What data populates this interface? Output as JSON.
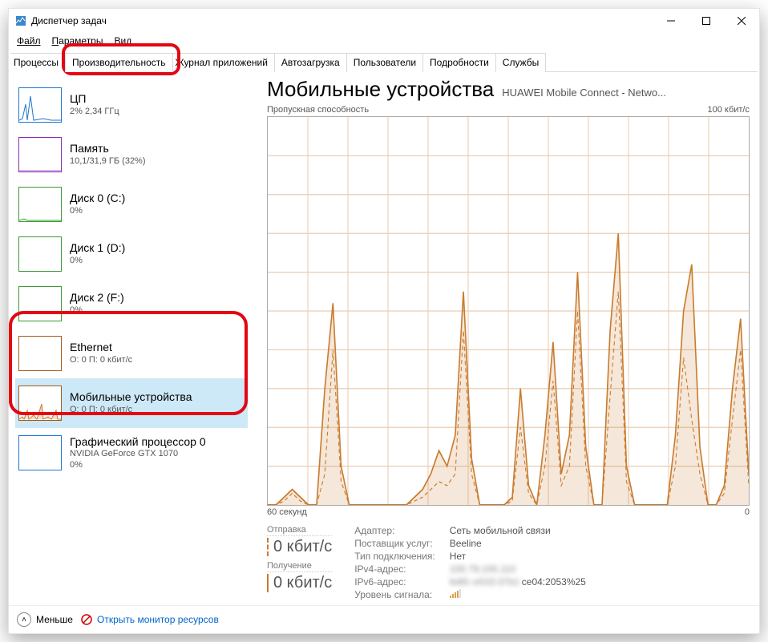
{
  "window": {
    "title": "Диспетчер задач"
  },
  "menu": {
    "file": "Файл",
    "options": "Параметры",
    "view": "Вид"
  },
  "tabs": {
    "processes": "Процессы",
    "performance": "Производительность",
    "apphistory": "Журнал приложений",
    "startup": "Автозагрузка",
    "users": "Пользователи",
    "details": "Подробности",
    "services": "Службы"
  },
  "sidebar": [
    {
      "title": "ЦП",
      "sub": "2% 2,34 ГГц"
    },
    {
      "title": "Память",
      "sub": "10,1/31,9 ГБ (32%)"
    },
    {
      "title": "Диск 0 (C:)",
      "sub": "0%"
    },
    {
      "title": "Диск 1 (D:)",
      "sub": "0%"
    },
    {
      "title": "Диск 2 (F:)",
      "sub": "0%"
    },
    {
      "title": "Ethernet",
      "sub": "О: 0 П: 0 кбит/с"
    },
    {
      "title": "Мобильные устройства",
      "sub": "О: 0 П: 0 кбит/с"
    },
    {
      "title": "Графический процессор 0",
      "sub": "NVIDIA GeForce GTX 1070",
      "sub2": "0%"
    }
  ],
  "main": {
    "title": "Мобильные устройства",
    "subtitle": "HUAWEI Mobile Connect - Netwo...",
    "chart_label_left": "Пропускная способность",
    "chart_label_right": "100 кбит/с",
    "x_left": "60 секунд",
    "x_right": "0",
    "send_label": "Отправка",
    "send_value": "0 кбит/с",
    "recv_label": "Получение",
    "recv_value": "0 кбит/с",
    "props": [
      {
        "k": "Адаптер:",
        "v": "Сеть мобильной связи"
      },
      {
        "k": "Поставщик услуг:",
        "v": "Beeline"
      },
      {
        "k": "Тип подключения:",
        "v": "Нет"
      },
      {
        "k": "IPv4-адрес:",
        "v": "100.79.105.110",
        "blur": true
      },
      {
        "k": "IPv6-адрес:",
        "v": "fe80::e533:37b1:ce04:2053%25",
        "blur_partial": true
      },
      {
        "k": "Уровень сигнала:",
        "v": "signal"
      }
    ]
  },
  "footer": {
    "fewer": "Меньше",
    "resmon": "Открыть монитор ресурсов"
  },
  "chart_data": {
    "type": "line",
    "xlabel": "60 секунд → 0",
    "ylabel": "Пропускная способность",
    "ylim": [
      0,
      100
    ],
    "unit": "кбит/с",
    "series": [
      {
        "name": "Получение",
        "style": "solid",
        "values": [
          0,
          0,
          2,
          4,
          2,
          0,
          0,
          30,
          52,
          10,
          0,
          0,
          0,
          0,
          0,
          0,
          0,
          0,
          2,
          4,
          8,
          14,
          10,
          18,
          55,
          12,
          0,
          0,
          0,
          0,
          2,
          30,
          5,
          0,
          18,
          42,
          8,
          18,
          60,
          15,
          0,
          0,
          45,
          70,
          10,
          0,
          0,
          0,
          0,
          0,
          18,
          50,
          62,
          15,
          0,
          0,
          5,
          30,
          48,
          8
        ]
      },
      {
        "name": "Отправка",
        "style": "dashed",
        "values": [
          0,
          0,
          1,
          3,
          1,
          0,
          0,
          8,
          40,
          6,
          0,
          0,
          0,
          0,
          0,
          0,
          0,
          0,
          1,
          2,
          4,
          6,
          5,
          8,
          45,
          8,
          0,
          0,
          0,
          0,
          1,
          20,
          3,
          0,
          10,
          32,
          5,
          10,
          50,
          10,
          0,
          0,
          28,
          55,
          6,
          0,
          0,
          0,
          0,
          0,
          10,
          38,
          22,
          8,
          0,
          0,
          3,
          22,
          40,
          5
        ]
      }
    ]
  }
}
